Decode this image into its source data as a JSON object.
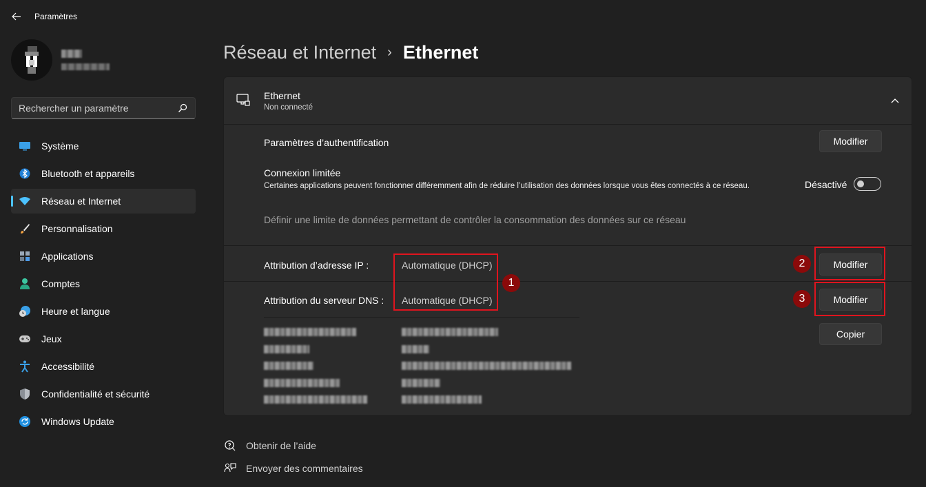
{
  "window": {
    "title": "Paramètres"
  },
  "search": {
    "placeholder": "Rechercher un paramètre"
  },
  "sidebar": {
    "items": [
      {
        "label": "Système",
        "icon": "system-icon",
        "active": false
      },
      {
        "label": "Bluetooth et appareils",
        "icon": "bluetooth-icon",
        "active": false
      },
      {
        "label": "Réseau et Internet",
        "icon": "wifi-icon",
        "active": true
      },
      {
        "label": "Personnalisation",
        "icon": "brush-icon",
        "active": false
      },
      {
        "label": "Applications",
        "icon": "apps-icon",
        "active": false
      },
      {
        "label": "Comptes",
        "icon": "account-icon",
        "active": false
      },
      {
        "label": "Heure et langue",
        "icon": "clock-globe-icon",
        "active": false
      },
      {
        "label": "Jeux",
        "icon": "gamepad-icon",
        "active": false
      },
      {
        "label": "Accessibilité",
        "icon": "accessibility-icon",
        "active": false
      },
      {
        "label": "Confidentialité et sécurité",
        "icon": "shield-icon",
        "active": false
      },
      {
        "label": "Windows Update",
        "icon": "update-icon",
        "active": false
      }
    ]
  },
  "header": {
    "breadcrumb_parent": "Réseau et Internet",
    "breadcrumb_separator": "›",
    "breadcrumb_current": "Ethernet"
  },
  "ethernet": {
    "title": "Ethernet",
    "status": "Non connecté",
    "auth_label": "Paramètres d’authentification",
    "auth_button": "Modifier",
    "metered_title": "Connexion limitée",
    "metered_desc": "Certaines applications peuvent fonctionner différemment afin de réduire l’utilisation des données lorsque vous êtes connectés à ce réseau.",
    "metered_state": "Désactivé",
    "metered_on": false,
    "data_limit_link": "Définir une limite de données permettant de contrôler la consommation des données sur ce réseau",
    "ip_label": "Attribution d’adresse IP :",
    "ip_value": "Automatique (DHCP)",
    "ip_button": "Modifier",
    "dns_label": "Attribution du serveur DNS :",
    "dns_value": "Automatique (DHCP)",
    "dns_button": "Modifier",
    "copy_button": "Copier"
  },
  "annotations": {
    "badge1": "1",
    "badge2": "2",
    "badge3": "3",
    "color": "#e0141e",
    "badge_color": "#8b0a0a"
  },
  "footer": {
    "help": "Obtenir de l’aide",
    "feedback": "Envoyer des commentaires"
  },
  "colors": {
    "background": "#202020",
    "card": "#2b2b2b",
    "accent": "#4cc2ff"
  }
}
